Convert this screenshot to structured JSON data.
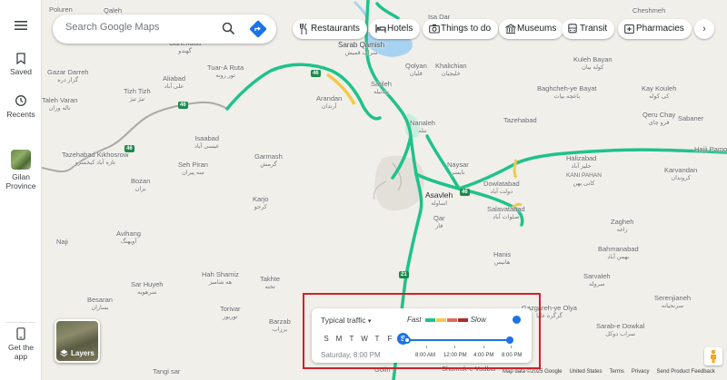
{
  "search": {
    "placeholder": "Search Google Maps"
  },
  "rail": {
    "saved": "Saved",
    "recents": "Recents",
    "province_line1": "Gilan",
    "province_line2": "Province",
    "get_app_line1": "Get the",
    "get_app_line2": "app"
  },
  "chips": {
    "restaurants": "Restaurants",
    "hotels": "Hotels",
    "things_to_do": "Things to do",
    "museums": "Museums",
    "transit": "Transit",
    "pharmacies": "Pharmacies"
  },
  "layers": {
    "label": "Layers"
  },
  "traffic": {
    "mode": "Typical traffic",
    "fast": "Fast",
    "slow": "Slow",
    "days": [
      "S",
      "M",
      "T",
      "W",
      "T",
      "F",
      "S"
    ],
    "status": "Saturday, 8:00 PM",
    "ticks": [
      "8:00 AM",
      "12:00 PM",
      "4:00 PM",
      "8:00 PM"
    ],
    "colors": {
      "fast": "#1ec28b",
      "mid": "#f2c94c",
      "slow": "#e06c5f",
      "slowest": "#b32a2a",
      "accent": "#1a73e8"
    }
  },
  "footer": {
    "map_data": "Map data ©2025 Google",
    "country": "United States",
    "terms": "Terms",
    "privacy": "Privacy",
    "feedback": "Send Product Feedback"
  },
  "places": {
    "poluren": "Poluren",
    "qaleh": "Qaleh",
    "isa_dar": "Isa Dar",
    "cheshmeh": "Cheshmeh",
    "gahenduu": "Gahenduu",
    "gahenduu_fa": "گهندو",
    "sarab_qamish": "Sarab Qamish",
    "sarab_qamish_fa": "سراب قمیش",
    "gazar_darreh": "Gazar Darreh",
    "gazar_darreh_fa": "گزار دره",
    "tuar_a_ruta": "Tuar-A Ruta",
    "tuar_a_ruta_fa": "تور روته",
    "aliabad": "Aliabad",
    "aliabad_fa": "علی آباد",
    "qolyan": "Qolyan",
    "qolyan_fa": "قلیان",
    "khalichian": "Khalichian",
    "khalichian_fa": "خلیچیان",
    "kuleh_bayan": "Kuleh Bayan",
    "kuleh_bayan_fa": "کوله بیان",
    "taleh_varan": "Taleh Varan",
    "taleh_varan_fa": "تاله وران",
    "tizh_tizh": "Tizh Tizh",
    "tizh_tizh_fa": "تیژ تیژ",
    "arandan": "Arandan",
    "arandan_fa": "آرندان",
    "satileh": "Satileh",
    "satileh_fa": "ساتیله",
    "baghcheh_ye_bayat": "Baghcheh-ye Bayat",
    "baghcheh_ye_bayat_fa": "باغچه بیات",
    "kay_kouleh": "Kay Kouleh",
    "kay_kouleh_fa": "کی کوله",
    "qeru_chay": "Qeru Chay",
    "qeru_chay_fa": "قرو چای",
    "tazehabad_ne": "Tazehabad",
    "sabaner": "Sabaner",
    "nanaleh": "Nanaleh",
    "nanaleh_fa": "ننله",
    "tazehabad_kikhosrow": "Tazehabad Kikhosrow",
    "tazehabad_kikhosrow_fa": "تازه آباد کیخسرو",
    "isaabad": "Isaabad",
    "isaabad_fa": "عیسی آباد",
    "garmash": "Garmash",
    "garmash_fa": "گرمش",
    "hajji_pamon": "Hajji Pamon",
    "karvandan": "Karvandan",
    "karvandan_fa": "کروندان",
    "halizabad": "Halizabad",
    "halizabad_fa": "حلیز آباد",
    "kani_pahan": "KANI PAHAN",
    "kani_pahan_fa": "کانی پهن",
    "seh_piran": "Seh Piran",
    "seh_piran_fa": "سه پیران",
    "naysar": "Naysar",
    "naysar_fa": "نایسر",
    "dowlatabad": "Dowlatabad",
    "dowlatabad_fa": "دولت آباد",
    "bozan": "Bozan",
    "bozan_fa": "بزان",
    "karjo": "Karjo",
    "karjo_fa": "کرجو",
    "asavleh": "Asavleh",
    "asavleh_fa": "اساوله",
    "salavatabad": "Salavatabad",
    "salavatabad_fa": "صلوات آباد",
    "qar": "Qar",
    "qar_fa": "قار",
    "zagheh": "Zagheh",
    "zagheh_fa": "زاغه",
    "avihang": "Avihang",
    "avihang_fa": "آویهنگ",
    "bahmanabad": "Bahmanabad",
    "bahmanabad_fa": "بهمن آباد",
    "naji": "Naji",
    "hanis": "Hanis",
    "hanis_fa": "هانیس",
    "hah_shamiz": "Hah Shamiz",
    "hah_shamiz_fa": "هه شامیز",
    "takhte": "Takhte",
    "takhte_fa": "تخته",
    "sarvaleh": "Sarvaleh",
    "sarvaleh_fa": "سروله",
    "sar_huyeh": "Sar Huyeh",
    "sar_huyeh_fa": "سرهویه",
    "serenjianeh": "Serenjianeh",
    "serenjianeh_fa": "سرنجیانه",
    "besaran": "Besaran",
    "besaran_fa": "بساران",
    "barzab": "Barzab",
    "barzab_fa": "برزاب",
    "torivar": "Torivar",
    "torivar_fa": "توریور",
    "sarab_e_dowkal": "Sarab-e Dowkal",
    "sarab_e_dowkal_fa": "سراب دوکل",
    "gazgareh_ye_olya": "Gazgareh-ye Olya",
    "gazgareh_ye_olya_fa": "گزگره علیا",
    "tangi_sar": "Tangi sar",
    "golin": "Golin",
    "shanrak_e_vadbar": "Shanrak-e Vadbar"
  },
  "roads": {
    "r46": "46",
    "r21": "21"
  }
}
